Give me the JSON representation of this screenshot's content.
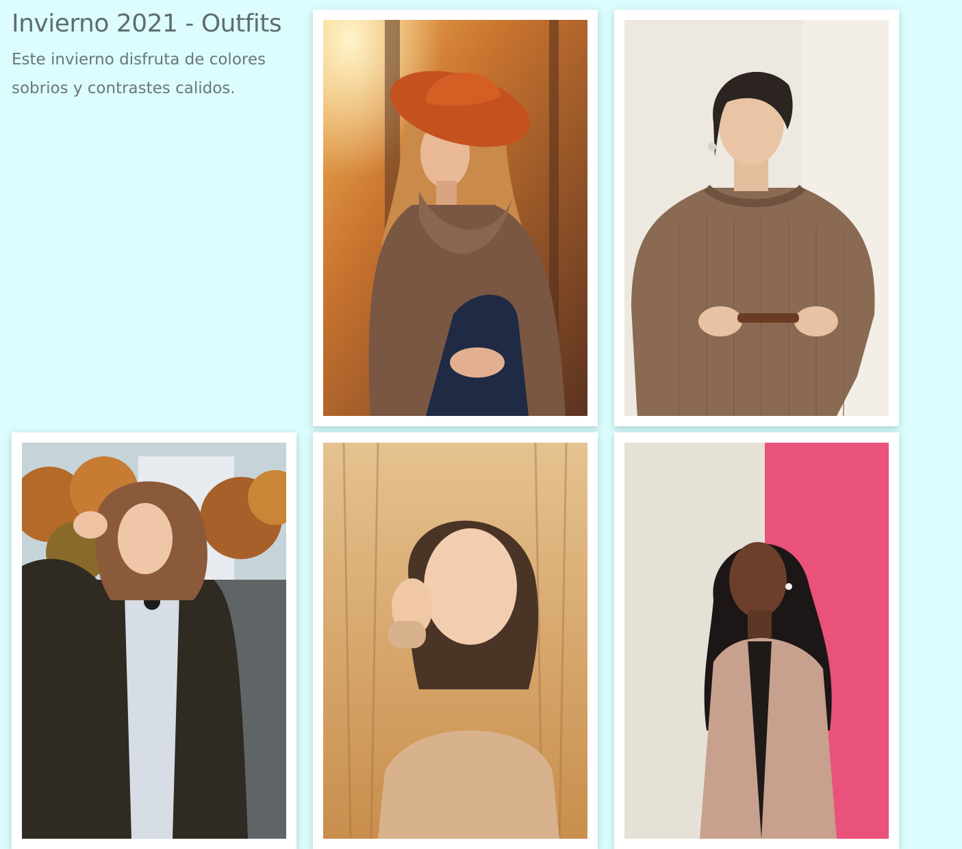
{
  "intro": {
    "title": "Invierno 2021 - Outfits",
    "description": "Este invierno disfruta de colores sobrios y contrastes calidos."
  },
  "colors": {
    "background": "#dcfcfd",
    "title_text": "#5f6b72",
    "card_frame": "#ffffff"
  },
  "gallery": {
    "photos": [
      {
        "subject": "woman-orange-hat-brown-turtleneck-autumn-trees"
      },
      {
        "subject": "woman-short-hair-brown-knit-sweater-holding-glasses"
      },
      {
        "subject": "woman-wavy-hair-dark-coat-street-autumn"
      },
      {
        "subject": "woman-hand-on-cheek-knit-sweater-golden-trees"
      },
      {
        "subject": "woman-long-dark-hair-pink-coat-pink-wall"
      }
    ]
  }
}
